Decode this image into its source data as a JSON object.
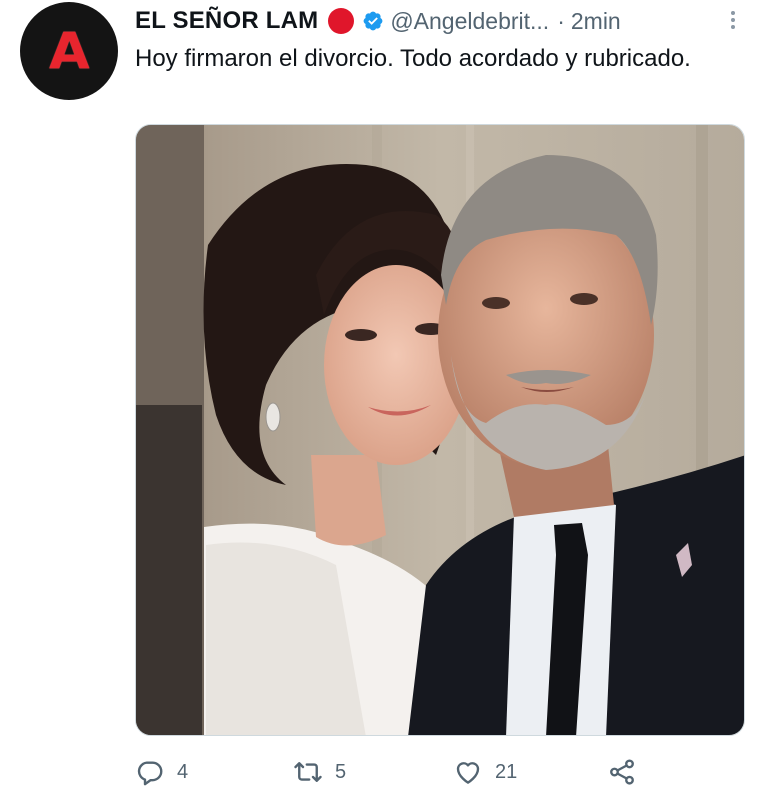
{
  "tweet": {
    "display_name": "EL SEÑOR LAM",
    "handle": "@Angeldebrit...",
    "separator": "·",
    "time": "2min",
    "text": "Hoy firmaron el divorcio. Todo acordado y rubricado.",
    "avatar_letter": "A"
  },
  "icons": {
    "status_dot": "red-circle",
    "verified": "verified-badge-icon",
    "more": "more-vertical-icon",
    "reply": "reply-icon",
    "retweet": "retweet-icon",
    "like": "heart-icon",
    "share": "share-icon"
  },
  "actions": {
    "reply_count": "4",
    "retweet_count": "5",
    "like_count": "21"
  },
  "colors": {
    "accent_blue": "#1d9bf0",
    "status_red": "#e0162b",
    "avatar_bg": "#141414",
    "avatar_letter": "#e8252e",
    "secondary_text": "#536471"
  }
}
